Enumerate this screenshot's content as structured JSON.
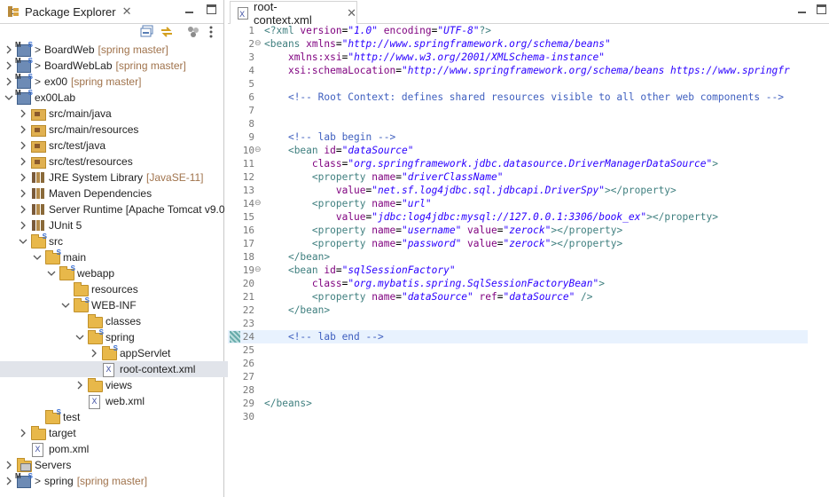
{
  "explorer": {
    "title": "Package Explorer",
    "close": "✕",
    "tree": [
      {
        "indent": 0,
        "twisty": ">",
        "icon": "project-icon",
        "prefix": ">",
        "label": "BoardWeb",
        "decor": "[spring master]"
      },
      {
        "indent": 0,
        "twisty": ">",
        "icon": "project-icon",
        "prefix": ">",
        "label": "BoardWebLab",
        "decor": "[spring master]"
      },
      {
        "indent": 0,
        "twisty": ">",
        "icon": "project-icon",
        "prefix": ">",
        "label": "ex00",
        "decor": "[spring master]"
      },
      {
        "indent": 0,
        "twisty": "v",
        "icon": "project-icon",
        "prefix": "",
        "label": "ex00Lab",
        "decor": ""
      },
      {
        "indent": 1,
        "twisty": ">",
        "icon": "package-folder-icon",
        "prefix": "",
        "label": "src/main/java",
        "decor": ""
      },
      {
        "indent": 1,
        "twisty": ">",
        "icon": "package-folder-icon",
        "prefix": "",
        "label": "src/main/resources",
        "decor": ""
      },
      {
        "indent": 1,
        "twisty": ">",
        "icon": "package-folder-icon",
        "prefix": "",
        "label": "src/test/java",
        "decor": ""
      },
      {
        "indent": 1,
        "twisty": ">",
        "icon": "package-folder-icon",
        "prefix": "",
        "label": "src/test/resources",
        "decor": ""
      },
      {
        "indent": 1,
        "twisty": ">",
        "icon": "library-icon",
        "prefix": "",
        "label": "JRE System Library",
        "decor": "[JavaSE-11]"
      },
      {
        "indent": 1,
        "twisty": ">",
        "icon": "library-icon",
        "prefix": "",
        "label": "Maven Dependencies",
        "decor": ""
      },
      {
        "indent": 1,
        "twisty": ">",
        "icon": "library-icon",
        "prefix": "",
        "label": "Server Runtime [Apache Tomcat v9.0",
        "decor": ""
      },
      {
        "indent": 1,
        "twisty": ">",
        "icon": "library-icon",
        "prefix": "",
        "label": "JUnit 5",
        "decor": ""
      },
      {
        "indent": 1,
        "twisty": "v",
        "icon": "folder-icon",
        "prefix": "",
        "label": "src",
        "decor": ""
      },
      {
        "indent": 2,
        "twisty": "v",
        "icon": "folder-icon",
        "prefix": "",
        "label": "main",
        "decor": ""
      },
      {
        "indent": 3,
        "twisty": "v",
        "icon": "folder-icon",
        "prefix": "",
        "label": "webapp",
        "decor": ""
      },
      {
        "indent": 4,
        "twisty": "",
        "icon": "folder-icon",
        "prefix": "",
        "label": "resources",
        "decor": ""
      },
      {
        "indent": 4,
        "twisty": "v",
        "icon": "folder-icon",
        "prefix": "",
        "label": "WEB-INF",
        "decor": ""
      },
      {
        "indent": 5,
        "twisty": "",
        "icon": "folder-icon",
        "prefix": "",
        "label": "classes",
        "decor": ""
      },
      {
        "indent": 5,
        "twisty": "v",
        "icon": "folder-icon",
        "prefix": "",
        "label": "spring",
        "decor": ""
      },
      {
        "indent": 6,
        "twisty": ">",
        "icon": "folder-icon",
        "prefix": "",
        "label": "appServlet",
        "decor": ""
      },
      {
        "indent": 6,
        "twisty": "",
        "icon": "xml-file-icon",
        "prefix": "",
        "label": "root-context.xml",
        "decor": "",
        "selected": true
      },
      {
        "indent": 5,
        "twisty": ">",
        "icon": "folder-icon",
        "prefix": "",
        "label": "views",
        "decor": ""
      },
      {
        "indent": 5,
        "twisty": "",
        "icon": "xml-file-icon",
        "prefix": "",
        "label": "web.xml",
        "decor": ""
      },
      {
        "indent": 2,
        "twisty": "",
        "icon": "folder-icon",
        "prefix": "",
        "label": "test",
        "decor": ""
      },
      {
        "indent": 1,
        "twisty": ">",
        "icon": "folder-icon",
        "prefix": "",
        "label": "target",
        "decor": ""
      },
      {
        "indent": 1,
        "twisty": "",
        "icon": "xml-file-icon",
        "prefix": "",
        "label": "pom.xml",
        "decor": ""
      },
      {
        "indent": 0,
        "twisty": ">",
        "icon": "server-folder-icon",
        "prefix": "",
        "label": "Servers",
        "decor": ""
      },
      {
        "indent": 0,
        "twisty": ">",
        "icon": "project-icon",
        "prefix": ">",
        "label": "spring",
        "decor": "[spring master]"
      }
    ]
  },
  "editor": {
    "tab_label": "root-context.xml",
    "close": "✕",
    "current_line": 24,
    "lines": [
      {
        "n": "1",
        "fold": "",
        "segs": [
          [
            "pi",
            "<?xml "
          ],
          [
            "attr",
            "version"
          ],
          [
            "",
            "="
          ],
          [
            "val",
            "\"1.0\""
          ],
          [
            "attr",
            " encoding"
          ],
          [
            "",
            "="
          ],
          [
            "val",
            "\"UTF-8\""
          ],
          [
            "pi",
            "?>"
          ]
        ]
      },
      {
        "n": "2",
        "fold": "⊖",
        "segs": [
          [
            "tag",
            "<beans "
          ],
          [
            "attr",
            "xmlns"
          ],
          [
            "",
            "="
          ],
          [
            "val",
            "\"http://www.springframework.org/schema/beans\""
          ]
        ]
      },
      {
        "n": "3",
        "fold": "",
        "segs": [
          [
            "",
            "    "
          ],
          [
            "attr",
            "xmlns:xsi"
          ],
          [
            "",
            "="
          ],
          [
            "val",
            "\"http://www.w3.org/2001/XMLSchema-instance\""
          ]
        ]
      },
      {
        "n": "4",
        "fold": "",
        "segs": [
          [
            "",
            "    "
          ],
          [
            "attr",
            "xsi:schemaLocation"
          ],
          [
            "",
            "="
          ],
          [
            "val",
            "\"http://www.springframework.org/schema/beans https://www.springfr"
          ]
        ]
      },
      {
        "n": "5",
        "fold": "",
        "segs": []
      },
      {
        "n": "6",
        "fold": "",
        "segs": [
          [
            "",
            "    "
          ],
          [
            "cmt",
            "<!-- Root Context: defines shared resources visible to all other web components -->"
          ]
        ]
      },
      {
        "n": "7",
        "fold": "",
        "segs": []
      },
      {
        "n": "8",
        "fold": "",
        "segs": []
      },
      {
        "n": "9",
        "fold": "",
        "segs": [
          [
            "",
            "    "
          ],
          [
            "cmt",
            "<!-- lab begin -->"
          ]
        ]
      },
      {
        "n": "10",
        "fold": "⊖",
        "segs": [
          [
            "",
            "    "
          ],
          [
            "tag",
            "<bean "
          ],
          [
            "attr",
            "id"
          ],
          [
            "",
            "="
          ],
          [
            "val",
            "\"dataSource\""
          ]
        ]
      },
      {
        "n": "11",
        "fold": "",
        "segs": [
          [
            "",
            "        "
          ],
          [
            "attr",
            "class"
          ],
          [
            "",
            "="
          ],
          [
            "val",
            "\"org.springframework.jdbc.datasource.DriverManagerDataSource\""
          ],
          [
            "tag",
            ">"
          ]
        ]
      },
      {
        "n": "12",
        "fold": "",
        "segs": [
          [
            "",
            "        "
          ],
          [
            "tag",
            "<property "
          ],
          [
            "attr",
            "name"
          ],
          [
            "",
            "="
          ],
          [
            "val",
            "\"driverClassName\""
          ]
        ]
      },
      {
        "n": "13",
        "fold": "",
        "segs": [
          [
            "",
            "            "
          ],
          [
            "attr",
            "value"
          ],
          [
            "",
            "="
          ],
          [
            "val",
            "\"net.sf.log4jdbc.sql.jdbcapi.DriverSpy\""
          ],
          [
            "tag",
            "></property>"
          ]
        ]
      },
      {
        "n": "14",
        "fold": "⊖",
        "segs": [
          [
            "",
            "        "
          ],
          [
            "tag",
            "<property "
          ],
          [
            "attr",
            "name"
          ],
          [
            "",
            "="
          ],
          [
            "val",
            "\"url\""
          ]
        ]
      },
      {
        "n": "15",
        "fold": "",
        "segs": [
          [
            "",
            "            "
          ],
          [
            "attr",
            "value"
          ],
          [
            "",
            "="
          ],
          [
            "val",
            "\"jdbc:log4jdbc:mysql://127.0.0.1:3306/book_ex\""
          ],
          [
            "tag",
            "></property>"
          ]
        ]
      },
      {
        "n": "16",
        "fold": "",
        "segs": [
          [
            "",
            "        "
          ],
          [
            "tag",
            "<property "
          ],
          [
            "attr",
            "name"
          ],
          [
            "",
            "="
          ],
          [
            "val",
            "\"username\""
          ],
          [
            "attr",
            " value"
          ],
          [
            "",
            "="
          ],
          [
            "val",
            "\"zerock\""
          ],
          [
            "tag",
            "></property>"
          ]
        ]
      },
      {
        "n": "17",
        "fold": "",
        "segs": [
          [
            "",
            "        "
          ],
          [
            "tag",
            "<property "
          ],
          [
            "attr",
            "name"
          ],
          [
            "",
            "="
          ],
          [
            "val",
            "\"password\""
          ],
          [
            "attr",
            " value"
          ],
          [
            "",
            "="
          ],
          [
            "val",
            "\"zerock\""
          ],
          [
            "tag",
            "></property>"
          ]
        ]
      },
      {
        "n": "18",
        "fold": "",
        "segs": [
          [
            "",
            "    "
          ],
          [
            "tag",
            "</bean>"
          ]
        ]
      },
      {
        "n": "19",
        "fold": "⊖",
        "segs": [
          [
            "",
            "    "
          ],
          [
            "tag",
            "<bean "
          ],
          [
            "attr",
            "id"
          ],
          [
            "",
            "="
          ],
          [
            "val",
            "\"sqlSessionFactory\""
          ]
        ]
      },
      {
        "n": "20",
        "fold": "",
        "segs": [
          [
            "",
            "        "
          ],
          [
            "attr",
            "class"
          ],
          [
            "",
            "="
          ],
          [
            "val",
            "\"org.mybatis.spring.SqlSessionFactoryBean\""
          ],
          [
            "tag",
            ">"
          ]
        ]
      },
      {
        "n": "21",
        "fold": "",
        "segs": [
          [
            "",
            "        "
          ],
          [
            "tag",
            "<property "
          ],
          [
            "attr",
            "name"
          ],
          [
            "",
            "="
          ],
          [
            "val",
            "\"dataSource\""
          ],
          [
            "attr",
            " ref"
          ],
          [
            "",
            "="
          ],
          [
            "val",
            "\"dataSource\""
          ],
          [
            "tag",
            " />"
          ]
        ]
      },
      {
        "n": "22",
        "fold": "",
        "segs": [
          [
            "",
            "    "
          ],
          [
            "tag",
            "</bean>"
          ]
        ]
      },
      {
        "n": "23",
        "fold": "",
        "segs": []
      },
      {
        "n": "24",
        "fold": "",
        "segs": [
          [
            "",
            "    "
          ],
          [
            "cmt",
            "<!-- lab end -->"
          ]
        ]
      },
      {
        "n": "25",
        "fold": "",
        "segs": []
      },
      {
        "n": "26",
        "fold": "",
        "segs": []
      },
      {
        "n": "27",
        "fold": "",
        "segs": []
      },
      {
        "n": "28",
        "fold": "",
        "segs": []
      },
      {
        "n": "29",
        "fold": "",
        "segs": [
          [
            "tag",
            "</beans>"
          ]
        ]
      },
      {
        "n": "30",
        "fold": "",
        "segs": []
      }
    ]
  },
  "colors": {
    "tag": "#3f7f7f",
    "attr": "#7f007f",
    "value": "#2a00ff",
    "comment": "#3f5fbf",
    "selection": "#e1e4ea",
    "current_line": "#e8f2fe",
    "decoration": "#a0734c"
  }
}
